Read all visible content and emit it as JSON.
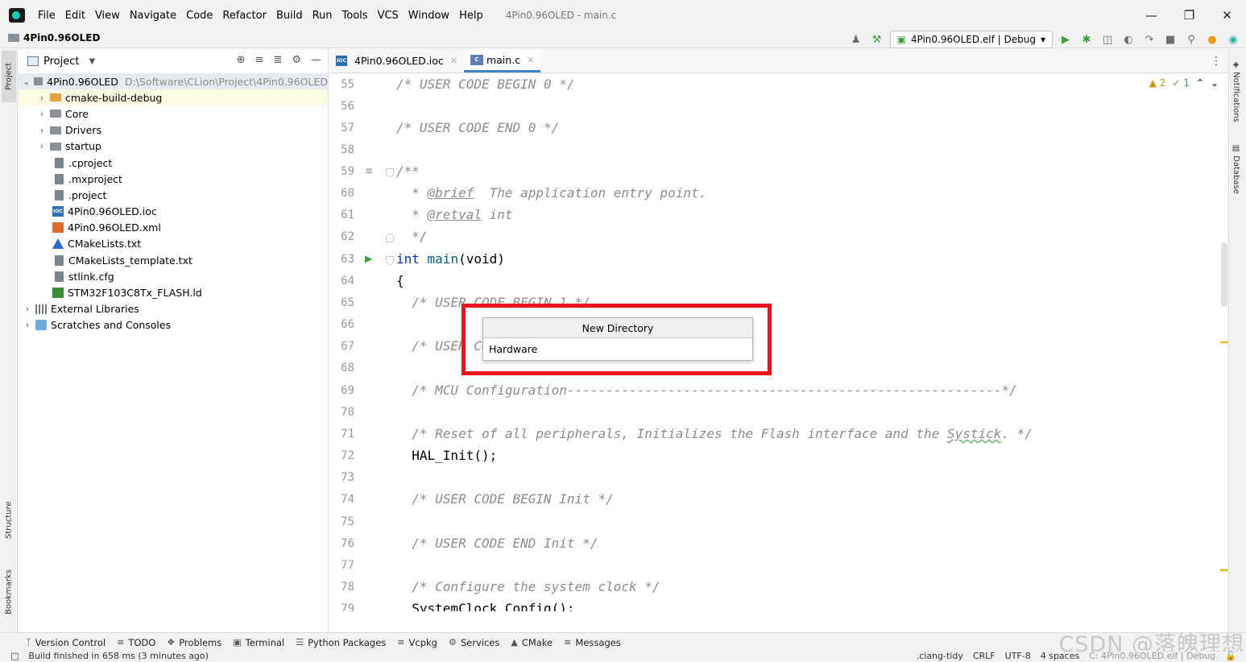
{
  "menubar": {
    "items": [
      {
        "label": "File"
      },
      {
        "label": "Edit"
      },
      {
        "label": "View"
      },
      {
        "label": "Navigate"
      },
      {
        "label": "Code"
      },
      {
        "label": "Refactor"
      },
      {
        "label": "Build"
      },
      {
        "label": "Run"
      },
      {
        "label": "Tools"
      },
      {
        "label": "VCS"
      },
      {
        "label": "Window"
      },
      {
        "label": "Help"
      }
    ],
    "window_title": "4Pin0.96OLED - main.c",
    "minimize": "—",
    "maximize": "❐",
    "close": "✕"
  },
  "navbar": {
    "project_name": "4Pin0.96OLED",
    "run_config": "4Pin0.96OLED.elf | Debug"
  },
  "left_stripe": {
    "project": "Project",
    "structure": "Structure",
    "bookmarks": "Bookmarks"
  },
  "project_panel": {
    "title": "Project",
    "root": {
      "name": "4Pin0.96OLED",
      "path": "D:\\Software\\CLion\\Project\\4Pin0.96OLED"
    },
    "items": [
      {
        "label": "cmake-build-debug",
        "type": "folder-orange",
        "expandable": true
      },
      {
        "label": "Core",
        "type": "folder",
        "expandable": true
      },
      {
        "label": "Drivers",
        "type": "folder",
        "expandable": true
      },
      {
        "label": "startup",
        "type": "folder",
        "expandable": true
      },
      {
        "label": ".cproject",
        "type": "file"
      },
      {
        "label": ".mxproject",
        "type": "file"
      },
      {
        "label": ".project",
        "type": "file"
      },
      {
        "label": "4Pin0.96OLED.ioc",
        "type": "ioc"
      },
      {
        "label": "4Pin0.96OLED.xml",
        "type": "xml"
      },
      {
        "label": "CMakeLists.txt",
        "type": "cmake"
      },
      {
        "label": "CMakeLists_template.txt",
        "type": "file"
      },
      {
        "label": "stlink.cfg",
        "type": "file"
      },
      {
        "label": "STM32F103C8Tx_FLASH.ld",
        "type": "ld"
      }
    ],
    "external_libraries": "External Libraries",
    "scratches": "Scratches and Consoles"
  },
  "editor_tabs": [
    {
      "label": "4Pin0.96OLED.ioc",
      "active": false
    },
    {
      "label": "main.c",
      "active": true
    }
  ],
  "inspection": {
    "warnings": "2",
    "ok": "1"
  },
  "code_lines": [
    {
      "n": "55",
      "text": "/* USER CODE BEGIN 0 */"
    },
    {
      "n": "56",
      "text": ""
    },
    {
      "n": "57",
      "text": "/* USER CODE END 0 */"
    },
    {
      "n": "58",
      "text": ""
    },
    {
      "n": "59",
      "text": "/**"
    },
    {
      "n": "60",
      "text": "  * @brief  The application entry point."
    },
    {
      "n": "61",
      "text": "  * @retval int"
    },
    {
      "n": "62",
      "text": "  */"
    },
    {
      "n": "63",
      "text": "int main(void)"
    },
    {
      "n": "64",
      "text": "{"
    },
    {
      "n": "65",
      "text": "  /* USER CODE BEGIN 1 */"
    },
    {
      "n": "66",
      "text": ""
    },
    {
      "n": "67",
      "text": "  /* USER CODE END 1 */"
    },
    {
      "n": "68",
      "text": ""
    },
    {
      "n": "69",
      "text": "  /* MCU Configuration--------------------------------------------------------*/"
    },
    {
      "n": "70",
      "text": ""
    },
    {
      "n": "71",
      "text": "  /* Reset of all peripherals, Initializes the Flash interface and the Systick. */"
    },
    {
      "n": "72",
      "text": "  HAL_Init();"
    },
    {
      "n": "73",
      "text": ""
    },
    {
      "n": "74",
      "text": "  /* USER CODE BEGIN Init */"
    },
    {
      "n": "75",
      "text": ""
    },
    {
      "n": "76",
      "text": "  /* USER CODE END Init */"
    },
    {
      "n": "77",
      "text": ""
    },
    {
      "n": "78",
      "text": "  /* Configure the system clock */"
    },
    {
      "n": "79",
      "text": "  SystemClock_Config();"
    }
  ],
  "code_parts": {
    "l60_pre": "  * ",
    "l60_tag": "@brief",
    "l60_post": "  The application entry point.",
    "l61_pre": "  * ",
    "l61_tag": "@retval",
    "l61_post": " int",
    "l63_kw": "int",
    "l63_fn": " main",
    "l63_rest": "(void)",
    "l71_pre": "  /* Reset of all peripherals, Initializes the Flash interface and the ",
    "l71_sq": "Systick",
    "l71_post": ". */"
  },
  "popup": {
    "title": "New Directory",
    "value": "Hardware"
  },
  "highlight_color": "#e8131b",
  "right_stripe": {
    "notifications": "Notifications",
    "database": "Database"
  },
  "bottom_tools": [
    {
      "label": "Version Control",
      "icon": "vcs-icon"
    },
    {
      "label": "TODO",
      "icon": "todo-icon"
    },
    {
      "label": "Problems",
      "icon": "problems-icon"
    },
    {
      "label": "Terminal",
      "icon": "terminal-icon"
    },
    {
      "label": "Python Packages",
      "icon": "packages-icon"
    },
    {
      "label": "Vcpkg",
      "icon": "vcpkg-icon"
    },
    {
      "label": "Services",
      "icon": "services-icon"
    },
    {
      "label": "CMake",
      "icon": "cmake-icon"
    },
    {
      "label": "Messages",
      "icon": "messages-icon"
    }
  ],
  "watermark": "CSDN @落魄理想",
  "status": {
    "message": "Build finished in 658 ms (3 minutes ago)",
    "clang_tidy": ".clang-tidy",
    "line_sep": "CRLF",
    "encoding": "UTF-8",
    "indent": "4 spaces",
    "context": "C: 4Pin0.96OLED.elf | Debug"
  }
}
